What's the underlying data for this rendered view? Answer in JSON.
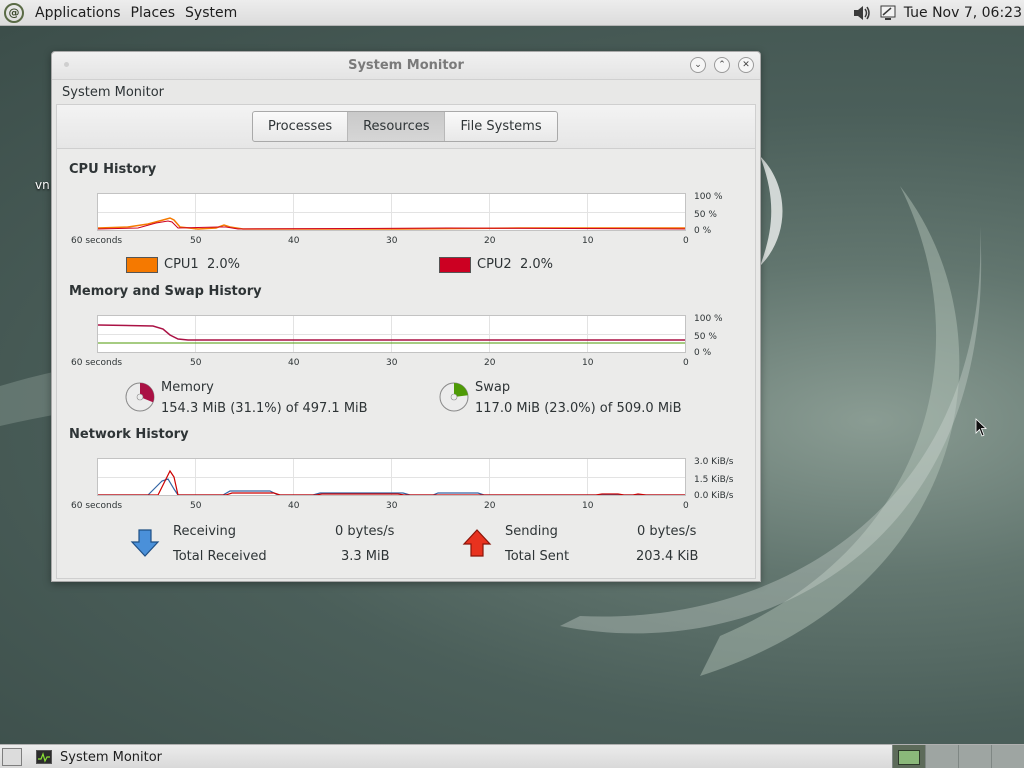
{
  "top_panel": {
    "menu": [
      "Applications",
      "Places",
      "System"
    ],
    "clock": "Tue Nov  7, 06:23",
    "icons": [
      "debian-logo-icon",
      "volume-icon",
      "network-icon"
    ]
  },
  "desktop": {
    "icon_label": "vn"
  },
  "window": {
    "title": "System Monitor",
    "menubar_title": "System Monitor",
    "tabs": [
      {
        "label": "Processes",
        "active": false
      },
      {
        "label": "Resources",
        "active": true
      },
      {
        "label": "File Systems",
        "active": false
      }
    ],
    "x_ticks": [
      "60 seconds",
      "50",
      "40",
      "30",
      "20",
      "10",
      "0"
    ],
    "cpu": {
      "title": "CPU History",
      "y_ticks": [
        "100 %",
        "50 %",
        "0 %"
      ],
      "cpu1": {
        "label": "CPU1",
        "value": "2.0%",
        "color": "#f57900"
      },
      "cpu2": {
        "label": "CPU2",
        "value": "2.0%",
        "color": "#cc0022"
      }
    },
    "memory": {
      "title": "Memory and Swap History",
      "y_ticks": [
        "100 %",
        "50 %",
        "0 %"
      ],
      "mem": {
        "label": "Memory",
        "detail": "154.3 MiB (31.1%) of 497.1 MiB",
        "color": "#aa1144",
        "fraction": 0.311
      },
      "swap": {
        "label": "Swap",
        "detail": "117.0 MiB (23.0%) of 509.0 MiB",
        "color": "#4e9a06",
        "fraction": 0.23
      }
    },
    "network": {
      "title": "Network History",
      "y_ticks": [
        "3.0 KiB/s",
        "1.5 KiB/s",
        "0.0 KiB/s"
      ],
      "receiving_label": "Receiving",
      "receiving_value": "0 bytes/s",
      "total_received_label": "Total Received",
      "total_received_value": "3.3 MiB",
      "sending_label": "Sending",
      "sending_value": "0 bytes/s",
      "total_sent_label": "Total Sent",
      "total_sent_value": "203.4 KiB",
      "recv_color": "#3465a4",
      "send_color": "#cc0000"
    }
  },
  "taskbar": {
    "item_label": "System Monitor"
  }
}
